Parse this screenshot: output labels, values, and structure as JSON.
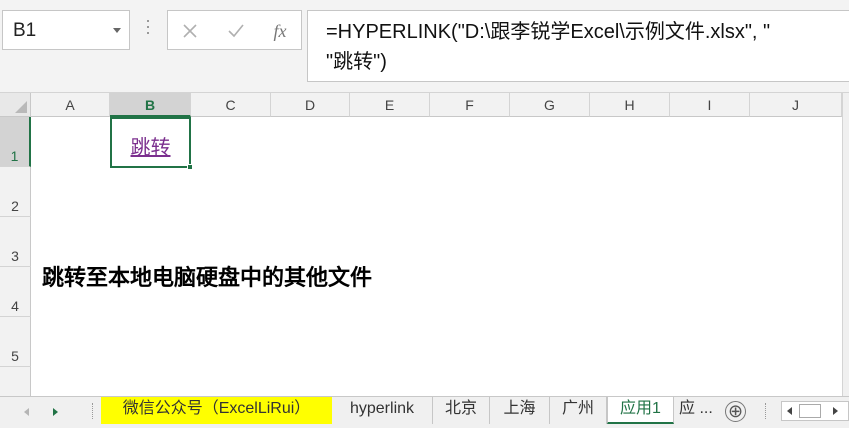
{
  "name_box": {
    "value": "B1"
  },
  "formula_bar": {
    "fx_label": "fx",
    "line1": "=HYPERLINK(\"D:\\跟李锐学Excel\\示例文件.xlsx\", \"",
    "line2": "\"跳转\")"
  },
  "grid": {
    "columns": [
      "A",
      "B",
      "C",
      "D",
      "E",
      "F",
      "G",
      "H",
      "I",
      "J"
    ],
    "rows": [
      "1",
      "2",
      "3",
      "4",
      "5"
    ],
    "active_column": "B",
    "active_row": "1",
    "cells": {
      "B1": "跳转",
      "A3": "跳转至本地电脑硬盘中的其他文件"
    }
  },
  "sheet_tabs": [
    {
      "label": "微信公众号（ExcelLiRui）",
      "highlighted": true
    },
    {
      "label": "hyperlink"
    },
    {
      "label": "北京"
    },
    {
      "label": "上海"
    },
    {
      "label": "广州"
    },
    {
      "label": "应用1",
      "active": true
    },
    {
      "label": "应 ..."
    }
  ],
  "add_sheet_label": "⊕",
  "colors": {
    "accent_green": "#217346",
    "link_purple": "#7b2f8e",
    "tab_highlight": "#ffff00"
  },
  "icons": {
    "cancel": "x-icon",
    "enter": "check-icon",
    "insert_function": "fx-icon",
    "name_box_dropdown": "chevron-down-icon",
    "add_sheet": "plus-circle-icon"
  }
}
